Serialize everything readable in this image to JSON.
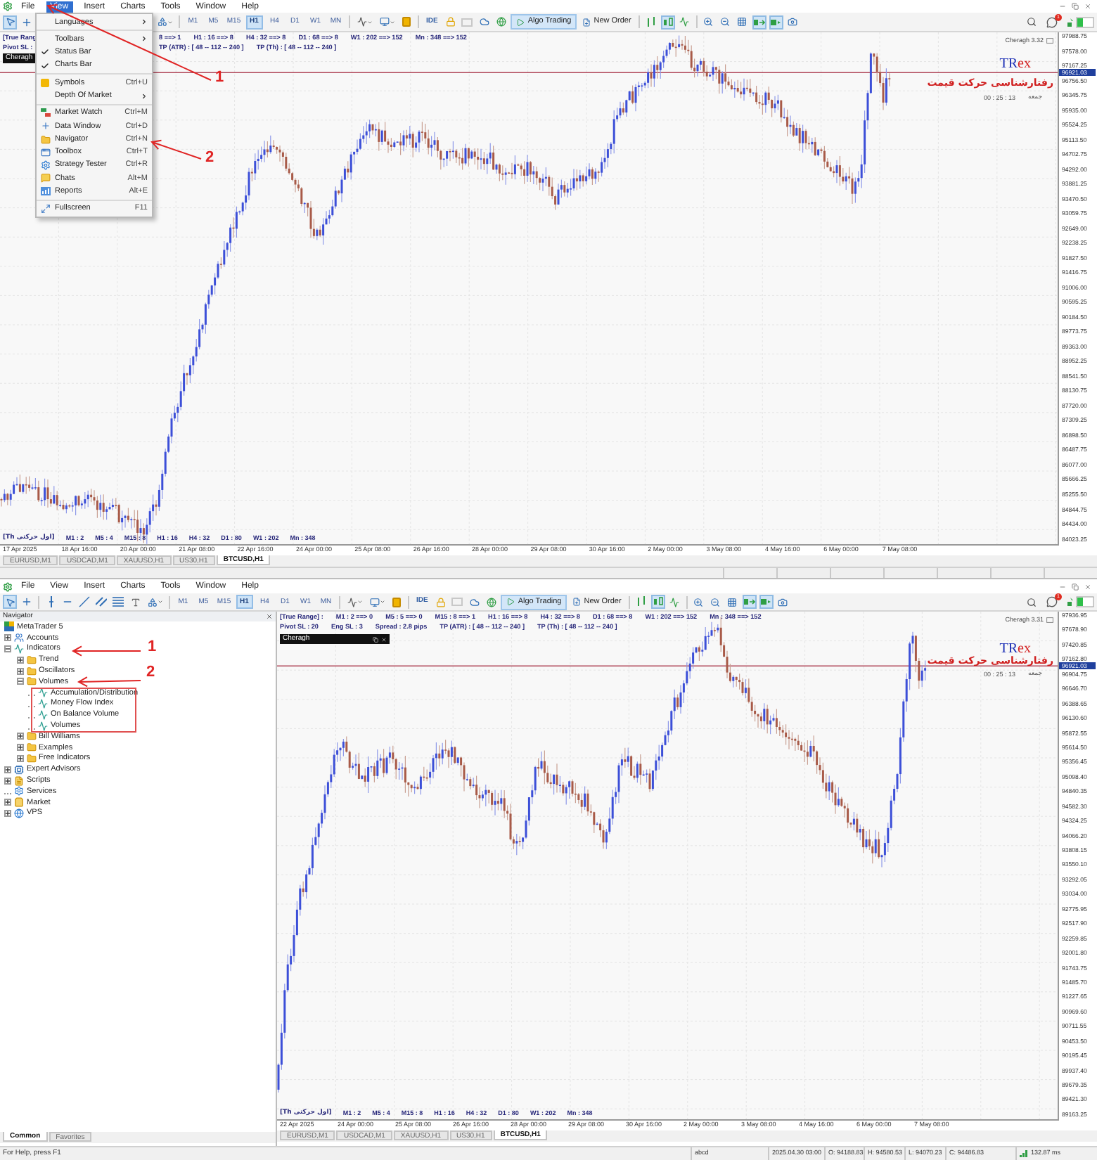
{
  "top_window": {
    "menu": [
      {
        "label": "File",
        "selected": false
      },
      {
        "label": "View",
        "selected": true
      },
      {
        "label": "Insert",
        "selected": false
      },
      {
        "label": "Charts",
        "selected": false
      },
      {
        "label": "Tools",
        "selected": false
      },
      {
        "label": "Window",
        "selected": false
      },
      {
        "label": "Help",
        "selected": false
      }
    ],
    "toolbar": {
      "active_tools": {
        "cursor": true,
        "candlesticks": true,
        "chart_shift": true,
        "auto_scroll": true
      },
      "timeframes": [
        {
          "label": "M1",
          "selected": false
        },
        {
          "label": "M5",
          "selected": false
        },
        {
          "label": "M15",
          "selected": false
        },
        {
          "label": "H1",
          "selected": true
        },
        {
          "label": "H4",
          "selected": false
        },
        {
          "label": "D1",
          "selected": false
        },
        {
          "label": "W1",
          "selected": false
        },
        {
          "label": "MN",
          "selected": false
        }
      ],
      "ide": "IDE",
      "algo_trading": {
        "label": "Algo Trading",
        "on": true
      },
      "new_order": "New Order",
      "notification_count": "1"
    },
    "view_menu": {
      "groups": [
        [
          {
            "label": "Languages",
            "checked": false,
            "submenu": true
          }
        ],
        [
          {
            "label": "Toolbars",
            "checked": false,
            "submenu": true
          },
          {
            "label": "Status Bar",
            "checked": true,
            "submenu": false
          },
          {
            "label": "Charts Bar",
            "checked": true,
            "submenu": false
          }
        ],
        [
          {
            "label": "Symbols",
            "shortcut": "Ctrl+U",
            "checked": false,
            "submenu": false
          },
          {
            "label": "Depth Of Market",
            "checked": false,
            "submenu": true
          }
        ],
        [
          {
            "label": "Market Watch",
            "shortcut": "Ctrl+M",
            "checked": false,
            "submenu": false
          },
          {
            "label": "Data Window",
            "shortcut": "Ctrl+D",
            "checked": false,
            "submenu": false
          },
          {
            "label": "Navigator",
            "shortcut": "Ctrl+N",
            "checked": false,
            "submenu": false
          },
          {
            "label": "Toolbox",
            "shortcut": "Ctrl+T",
            "checked": false,
            "submenu": false
          },
          {
            "label": "Strategy Tester",
            "shortcut": "Ctrl+R",
            "checked": false,
            "submenu": false
          },
          {
            "label": "Chats",
            "shortcut": "Alt+M",
            "checked": false,
            "submenu": false
          },
          {
            "label": "Reports",
            "shortcut": "Alt+E",
            "checked": false,
            "submenu": false
          }
        ],
        [
          {
            "label": "Fullscreen",
            "shortcut": "F11",
            "checked": false,
            "submenu": false
          }
        ]
      ]
    },
    "annotations": [
      {
        "label": "1"
      },
      {
        "label": "2"
      }
    ],
    "chart": {
      "header_lines": [
        [
          "[True Rang",
          "8 ==> 1",
          "H1 : 16 ==> 8",
          "H4 : 32 ==> 8",
          "D1 : 68 ==> 8",
          "W1 : 202 ==> 152",
          "Mn : 348 ==> 152"
        ],
        [
          "Pivot SL :",
          "TP (ATR) : [ 48 -- 112 -- 240 ]",
          "TP (Th) : [ 48 -- 112 -- 240 ]"
        ]
      ],
      "indicator_label": "Cheragh",
      "version": "Cheragh 3.32",
      "logo": [
        "TR",
        "ex"
      ],
      "tagline": "رفتارشناسی حرکت قیمت",
      "timer": "00 : 25 : 13",
      "day": "جمعه",
      "footer": [
        "[Th اول حرکتی]",
        "M1 : 2",
        "M5 : 4",
        "M15 : 8",
        "H1 : 16",
        "H4 : 32",
        "D1 : 80",
        "W1 : 202",
        "Mn : 348"
      ],
      "price_axis": [
        "97988.75",
        "97578.00",
        "97167.25",
        "96756.50",
        "96345.75",
        "95935.00",
        "95524.25",
        "95113.50",
        "94702.75",
        "94292.00",
        "93881.25",
        "93470.50",
        "93059.75",
        "92649.00",
        "92238.25",
        "91827.50",
        "91416.75",
        "91006.00",
        "90595.25",
        "90184.50",
        "89773.75",
        "89363.00",
        "88952.25",
        "88541.50",
        "88130.75",
        "87720.00",
        "87309.25",
        "86898.50",
        "86487.75",
        "86077.00",
        "85666.25",
        "85255.50",
        "84844.75",
        "84434.00",
        "84023.25"
      ],
      "current_price": "96921.03",
      "time_axis": [
        "17 Apr 2025",
        "18 Apr 16:00",
        "20 Apr 00:00",
        "21 Apr 08:00",
        "22 Apr 16:00",
        "24 Apr 00:00",
        "25 Apr 08:00",
        "26 Apr 16:00",
        "28 Apr 00:00",
        "29 Apr 08:00",
        "30 Apr 16:00",
        "2 May 00:00",
        "3 May 08:00",
        "4 May 16:00",
        "6 May 00:00",
        "7 May 08:00"
      ]
    },
    "chart_tabs": [
      {
        "label": "EURUSD,M1",
        "selected": false
      },
      {
        "label": "USDCAD,M1",
        "selected": false
      },
      {
        "label": "XAUUSD,H1",
        "selected": false
      },
      {
        "label": "US30,H1",
        "selected": false
      },
      {
        "label": "BTCUSD,H1",
        "selected": true
      }
    ]
  },
  "bottom_window": {
    "menu": [
      {
        "label": "File",
        "selected": false
      },
      {
        "label": "View",
        "selected": false
      },
      {
        "label": "Insert",
        "selected": false
      },
      {
        "label": "Charts",
        "selected": false
      },
      {
        "label": "Tools",
        "selected": false
      },
      {
        "label": "Window",
        "selected": false
      },
      {
        "label": "Help",
        "selected": false
      }
    ],
    "toolbar": {
      "active_tools": {
        "cursor": true,
        "candlesticks": true,
        "chart_shift": true,
        "auto_scroll": true
      },
      "timeframes": [
        {
          "label": "M1",
          "selected": false
        },
        {
          "label": "M5",
          "selected": false
        },
        {
          "label": "M15",
          "selected": false
        },
        {
          "label": "H1",
          "selected": true
        },
        {
          "label": "H4",
          "selected": false
        },
        {
          "label": "D1",
          "selected": false
        },
        {
          "label": "W1",
          "selected": false
        },
        {
          "label": "MN",
          "selected": false
        }
      ],
      "ide": "IDE",
      "algo_trading": {
        "label": "Algo Trading",
        "on": true
      },
      "new_order": "New Order",
      "notification_count": "1"
    },
    "navigator": {
      "title": "Navigator",
      "tree": [
        {
          "label": "MetaTrader 5",
          "kind": "root",
          "children": [
            {
              "label": "Accounts",
              "kind": "branch",
              "expanded": false
            },
            {
              "label": "Indicators",
              "kind": "branch",
              "expanded": true,
              "children": [
                {
                  "label": "Trend",
                  "kind": "branch",
                  "expanded": false
                },
                {
                  "label": "Oscillators",
                  "kind": "branch",
                  "expanded": false
                },
                {
                  "label": "Volumes",
                  "kind": "branch",
                  "expanded": true,
                  "children": [
                    {
                      "label": "Accumulation/Distribution",
                      "kind": "leaf"
                    },
                    {
                      "label": "Money Flow Index",
                      "kind": "leaf"
                    },
                    {
                      "label": "On Balance Volume",
                      "kind": "leaf"
                    },
                    {
                      "label": "Volumes",
                      "kind": "leaf"
                    }
                  ]
                },
                {
                  "label": "Bill Williams",
                  "kind": "branch",
                  "expanded": false
                },
                {
                  "label": "Examples",
                  "kind": "branch",
                  "expanded": false
                },
                {
                  "label": "Free Indicators",
                  "kind": "branch",
                  "expanded": false
                }
              ]
            },
            {
              "label": "Expert Advisors",
              "kind": "branch",
              "expanded": false
            },
            {
              "label": "Scripts",
              "kind": "branch",
              "expanded": false
            },
            {
              "label": "Services",
              "kind": "leaf"
            },
            {
              "label": "Market",
              "kind": "branch",
              "expanded": false
            },
            {
              "label": "VPS",
              "kind": "branch",
              "expanded": false
            }
          ]
        }
      ],
      "tabs": [
        {
          "label": "Common",
          "selected": true
        },
        {
          "label": "Favorites",
          "selected": false
        }
      ]
    },
    "annotations": [
      {
        "label": "1"
      },
      {
        "label": "2"
      }
    ],
    "chart": {
      "header_lines": [
        [
          "[True Range] :",
          "M1 : 2 ==> 0",
          "M5 : 5 ==> 0",
          "M15 : 8 ==> 1",
          "H1 : 16 ==> 8",
          "H4 : 32 ==> 8",
          "D1 : 68 ==> 8",
          "W1 : 202 ==> 152",
          "Mn : 348 ==> 152"
        ],
        [
          "Pivot SL : 20",
          "Eng SL : 3",
          "Spread : 2.8 pips",
          "TP (ATR) : [ 48 -- 112 -- 240 ]",
          "TP (Th) : [ 48 -- 112 -- 240 ]"
        ]
      ],
      "indicator_label": "Cheragh",
      "version": "Cheragh 3.31",
      "logo": [
        "TR",
        "ex"
      ],
      "tagline": "رفتارشناسی حرکت قیمت",
      "timer": "00 : 25 : 13",
      "day": "جمعه",
      "footer": [
        "[Th اول حرکتی]",
        "M1 : 2",
        "M5 : 4",
        "M15 : 8",
        "H1 : 16",
        "H4 : 32",
        "D1 : 80",
        "W1 : 202",
        "Mn : 348"
      ],
      "price_axis": [
        "97936.95",
        "97678.90",
        "97420.85",
        "97162.80",
        "96904.75",
        "96646.70",
        "96388.65",
        "96130.60",
        "95872.55",
        "95614.50",
        "95356.45",
        "95098.40",
        "94840.35",
        "94582.30",
        "94324.25",
        "94066.20",
        "93808.15",
        "93550.10",
        "93292.05",
        "93034.00",
        "92775.95",
        "92517.90",
        "92259.85",
        "92001.80",
        "91743.75",
        "91485.70",
        "91227.65",
        "90969.60",
        "90711.55",
        "90453.50",
        "90195.45",
        "89937.40",
        "89679.35",
        "89421.30",
        "89163.25"
      ],
      "current_price": "96921.03",
      "time_axis": [
        "22 Apr 2025",
        "24 Apr 00:00",
        "25 Apr 08:00",
        "26 Apr 16:00",
        "28 Apr 00:00",
        "29 Apr 08:00",
        "30 Apr 16:00",
        "2 May 00:00",
        "3 May 08:00",
        "4 May 16:00",
        "6 May 00:00",
        "7 May 08:00"
      ]
    },
    "chart_tabs": [
      {
        "label": "EURUSD,M1",
        "selected": false
      },
      {
        "label": "USDCAD,M1",
        "selected": false
      },
      {
        "label": "XAUUSD,H1",
        "selected": false
      },
      {
        "label": "US30,H1",
        "selected": false
      },
      {
        "label": "BTCUSD,H1",
        "selected": true
      }
    ],
    "status_bar": [
      "For Help, press F1",
      "abcd",
      "2025.04.30 03:00",
      "O: 94188.83",
      "H: 94580.53",
      "L: 94070.23",
      "C: 94486.83",
      "132.87 ms"
    ]
  }
}
